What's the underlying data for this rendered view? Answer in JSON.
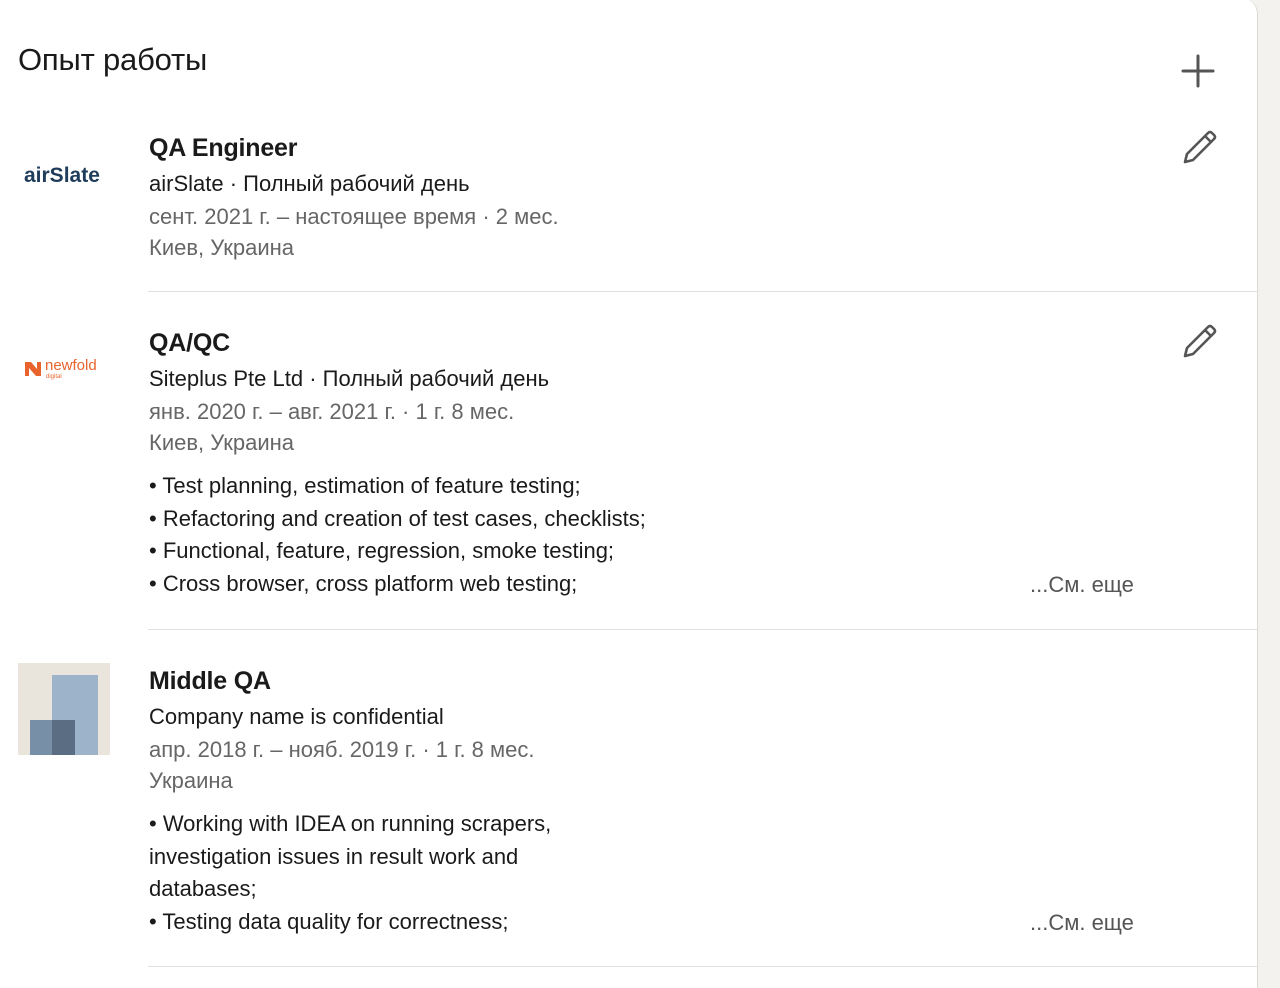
{
  "section": {
    "title": "Опыт работы",
    "add_icon": "plus-icon"
  },
  "experiences": [
    {
      "logo_text": "airSlate",
      "title": "QA Engineer",
      "company": "airSlate · Полный рабочий день",
      "dates": "сент. 2021 г. – настоящее время · 2 мес.",
      "location": "Киев, Украина",
      "edit_icon": "pencil-icon"
    },
    {
      "logo_text": "newfold",
      "logo_subtext": "digital",
      "logo_color": "#e8642c",
      "title": "QA/QC",
      "company": "Siteplus Pte Ltd · Полный рабочий день",
      "dates": "янв. 2020 г. – авг. 2021 г. · 1 г. 8 мес.",
      "location": "Киев, Украина",
      "description": [
        "• Test planning, estimation of feature testing;",
        "• Refactoring and creation of test cases, checklists;",
        "• Functional, feature, regression, smoke testing;",
        "• Cross browser, cross platform web testing;"
      ],
      "see_more": "...См. еще",
      "edit_icon": "pencil-icon"
    },
    {
      "logo_icon": "company-placeholder-icon",
      "title": "Middle QA",
      "company": "Company name is confidential",
      "dates": "апр. 2018 г. – нояб. 2019 г. · 1 г. 8 мес.",
      "location": "Украина",
      "description": [
        "• Working with IDEA on running scrapers,",
        "investigation issues in result work and",
        "databases;",
        "• Testing data quality for correctness;"
      ],
      "see_more": "...См. еще"
    }
  ],
  "colors": {
    "text_primary": "#1a1a1a",
    "text_secondary": "#666666",
    "airslate_brand": "#1f3c5a",
    "newfold_brand": "#e8642c"
  }
}
